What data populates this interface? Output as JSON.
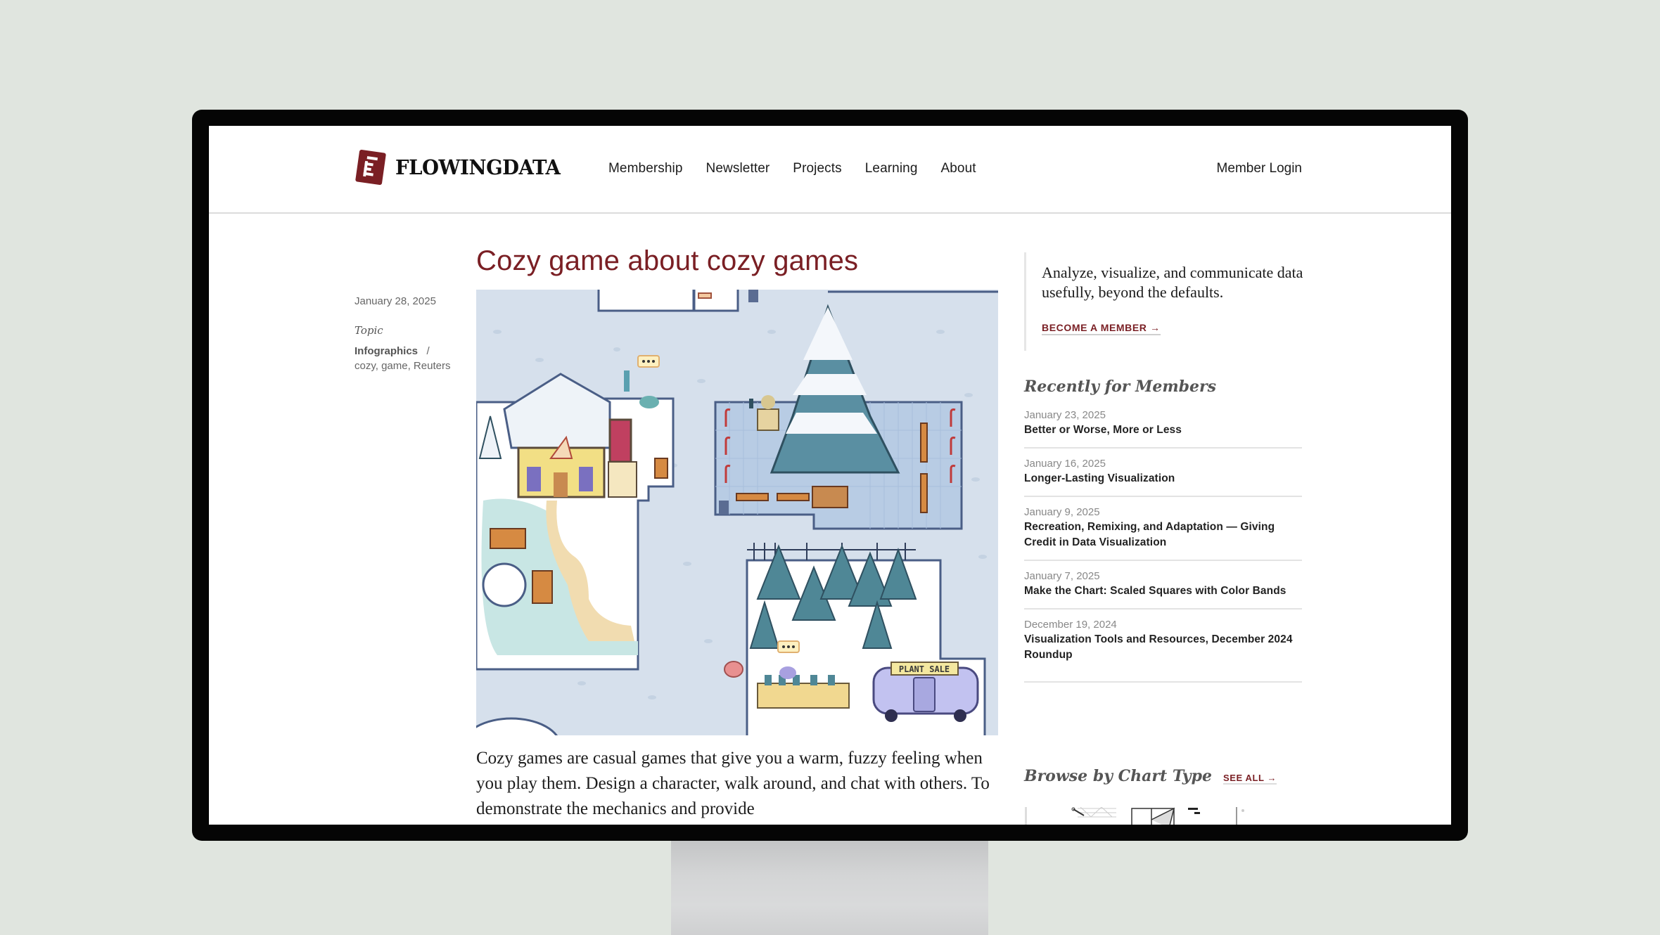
{
  "header": {
    "logo_text": "FLOWINGDATA",
    "nav": [
      "Membership",
      "Newsletter",
      "Projects",
      "Learning",
      "About"
    ],
    "login": "Member Login"
  },
  "article": {
    "title": "Cozy game about cozy games",
    "date": "January 28, 2025",
    "topic_label": "Topic",
    "category": "Infographics",
    "separator": "/",
    "tags": "cozy, game, Reuters",
    "image_sign": "PLANT SALE",
    "body": "Cozy games are casual games that give you a warm, fuzzy feeling when you play them. Design a character, walk around, and chat with others. To demonstrate the mechanics and provide"
  },
  "sidebar": {
    "promo_text": "Analyze, visualize, and communicate data usefully, beyond the defaults.",
    "promo_link": "BECOME A MEMBER →",
    "recent_heading": "Recently for Members",
    "recent": [
      {
        "date": "January 23, 2025",
        "title": "Better or Worse, More or Less"
      },
      {
        "date": "January 16, 2025",
        "title": "Longer-Lasting Visualization"
      },
      {
        "date": "January 9, 2025",
        "title": "Recreation, Remixing, and Adaptation — Giving Credit in Data Visualization"
      },
      {
        "date": "January 7, 2025",
        "title": "Make the Chart: Scaled Squares with Color Bands"
      },
      {
        "date": "December 19, 2024",
        "title": "Visualization Tools and Resources, December 2024 Roundup"
      }
    ],
    "browse_heading": "Browse by Chart Type",
    "see_all": "SEE ALL →"
  },
  "colors": {
    "accent": "#7a1f24",
    "background": "#e0e5df",
    "frame": "#050505"
  }
}
